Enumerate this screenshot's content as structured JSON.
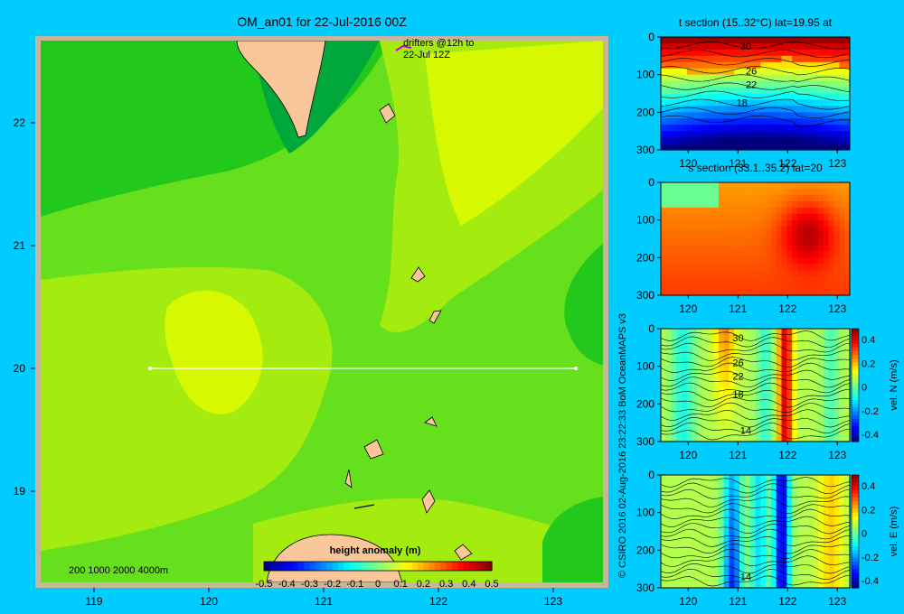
{
  "colors": {
    "background": "#00ccff",
    "land": "#f9c79a",
    "frame": "#c9b59a",
    "greens": [
      "#00a83c",
      "#22c81c",
      "#66e01c",
      "#a4ec10",
      "#d6f800",
      "#eaf200"
    ],
    "palette": [
      "#00007f",
      "#0000ff",
      "#007fff",
      "#00ffff",
      "#7fff7f",
      "#ffff00",
      "#ff7f00",
      "#ff0000",
      "#7f0000"
    ]
  },
  "map": {
    "title": "OM_an01 for 22-Jul-2016 00Z",
    "drifters_note": [
      "drifters @12h to",
      "22-Jul 12Z"
    ],
    "depth_legend": "200  1000  2000  4000m",
    "colorbar_label": "height anomaly  (m)",
    "colorbar_ticks": [
      "-0.5",
      "-0.4",
      "-0.3",
      "-0.2",
      "-0.1",
      "0",
      "0.1",
      "0.2",
      "0.3",
      "0.4",
      "0.5"
    ],
    "x_ticks": [
      "119",
      "120",
      "121",
      "122",
      "123"
    ],
    "y_ticks": [
      "22",
      "21",
      "20",
      "19"
    ]
  },
  "credit": "© CSIRO 2016   02-Aug-2016 23:22:33 BoM OceanMAPS v3",
  "panels": [
    {
      "title": "t section (15..32°C) lat=19.95 at",
      "y_ticks": [
        "0",
        "100",
        "200",
        "300"
      ],
      "x_ticks": [
        "120",
        "121",
        "122",
        "123"
      ],
      "contour_labels": [
        "30",
        "26",
        "22",
        "18"
      ]
    },
    {
      "title": "s section (33.1..35.2) lat=20",
      "y_ticks": [
        "0",
        "100",
        "200",
        "300"
      ],
      "x_ticks": [
        "120",
        "121",
        "122",
        "123"
      ],
      "contour_labels": []
    },
    {
      "title": "",
      "y_ticks": [
        "0",
        "100",
        "200",
        "300"
      ],
      "x_ticks": [
        "120",
        "121",
        "122",
        "123"
      ],
      "contour_labels": [
        "30",
        "26",
        "22",
        "18",
        "14"
      ],
      "colorbar_label": "vel. N  (m/s)",
      "colorbar_ticks": [
        "0.4",
        "0.2",
        "0",
        "-0.2",
        "-0.4"
      ]
    },
    {
      "title": "",
      "y_ticks": [
        "0",
        "100",
        "200",
        "300"
      ],
      "x_ticks": [
        "120",
        "121",
        "122",
        "123"
      ],
      "contour_labels": [
        "14"
      ],
      "colorbar_label": "vel. E  (m/s)",
      "colorbar_ticks": [
        "0.4",
        "0.2",
        "0",
        "-0.2",
        "-0.4"
      ]
    }
  ],
  "chart_data": [
    {
      "type": "heatmap",
      "title": "OM_an01 for 22-Jul-2016 00Z",
      "variable": "height anomaly (m)",
      "x_range": [
        118.5,
        123.5
      ],
      "y_range": [
        18.3,
        22.7
      ],
      "x_ticks": [
        119,
        120,
        121,
        122,
        123
      ],
      "y_ticks": [
        19,
        20,
        21,
        22
      ],
      "color_range": [
        -0.5,
        0.5
      ],
      "section_line": {
        "lat": 20.0,
        "lon_start": 119.5,
        "lon_end": 123.2
      }
    },
    {
      "type": "heatmap",
      "title": "t section (15..32°C) lat=19.95 at",
      "variable": "temperature",
      "color_range": [
        15,
        32
      ],
      "x_range": [
        119.5,
        123.2
      ],
      "depth_range": [
        0,
        300
      ],
      "contour_labels": [
        30,
        26,
        22,
        18
      ]
    },
    {
      "type": "heatmap",
      "title": "s section (33.1..35.2) lat=20",
      "variable": "salinity",
      "color_range": [
        33.1,
        35.2
      ],
      "x_range": [
        119.5,
        123.2
      ],
      "depth_range": [
        0,
        300
      ]
    },
    {
      "type": "heatmap",
      "variable": "vel. N (m/s)",
      "color_range": [
        -0.4,
        0.4
      ],
      "x_range": [
        119.5,
        123.2
      ],
      "depth_range": [
        0,
        300
      ],
      "contour_labels": [
        30,
        26,
        22,
        18,
        14
      ]
    },
    {
      "type": "heatmap",
      "variable": "vel. E (m/s)",
      "color_range": [
        -0.4,
        0.4
      ],
      "x_range": [
        119.5,
        123.2
      ],
      "depth_range": [
        0,
        300
      ],
      "contour_labels": [
        14
      ]
    }
  ]
}
